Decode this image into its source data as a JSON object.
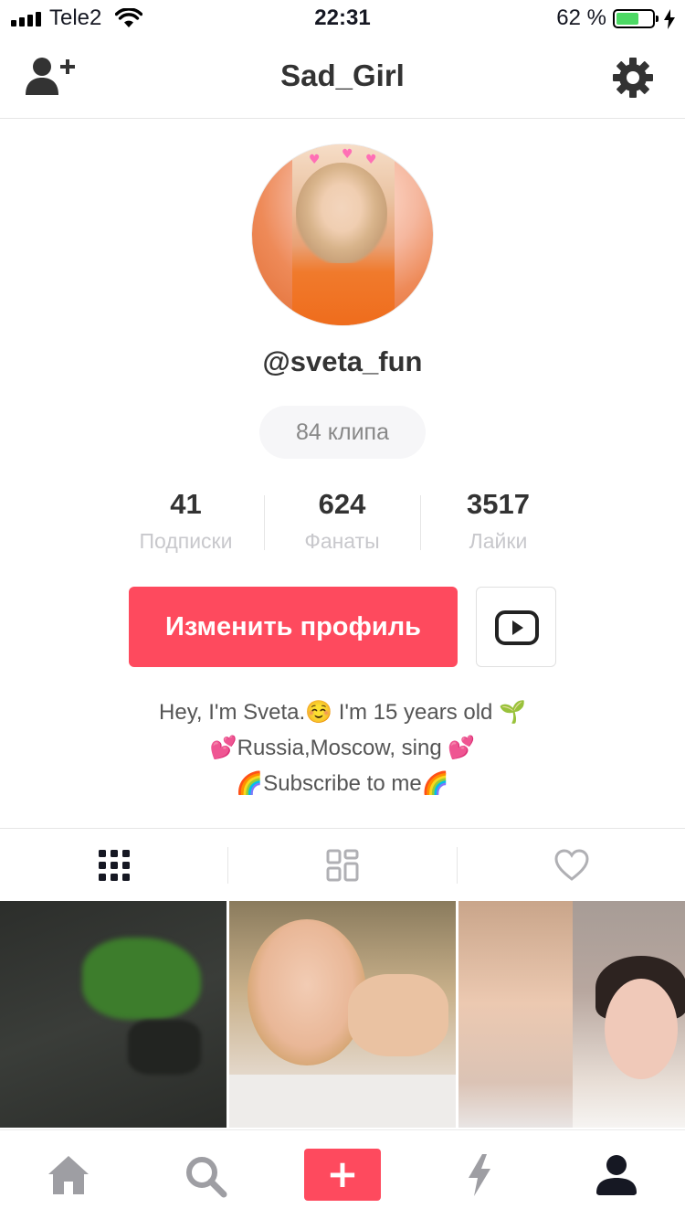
{
  "status_bar": {
    "carrier": "Tele2",
    "time": "22:31",
    "battery_percent_label": "62 %",
    "battery_level": 0.62,
    "icons": [
      "signal-icon",
      "wifi-icon",
      "battery-icon",
      "charging-bolt-icon"
    ]
  },
  "header": {
    "title": "Sad_Girl",
    "left_icon": "add-user-icon",
    "right_icon": "gear-icon"
  },
  "profile": {
    "username": "@sveta_fun",
    "clips_label": "84 клипа",
    "stats": [
      {
        "value": "41",
        "label": "Подписки"
      },
      {
        "value": "624",
        "label": "Фанаты"
      },
      {
        "value": "3517",
        "label": "Лайки"
      }
    ],
    "edit_button_label": "Изменить профиль",
    "youtube_icon": "youtube-icon",
    "bio_lines": [
      "Hey, I'm Sveta.☺️ I'm 15 years old 🌱",
      "💕Russia,Moscow, sing 💕",
      "🌈Subscribe to me🌈"
    ]
  },
  "tabs": [
    {
      "icon": "grid-icon",
      "active": true
    },
    {
      "icon": "collage-icon",
      "active": false
    },
    {
      "icon": "heart-icon",
      "active": false
    }
  ],
  "bottom_nav": {
    "items": [
      "home-icon",
      "search-icon",
      "plus-icon",
      "notifications-bolt-icon",
      "profile-icon"
    ],
    "plus_label": "+"
  },
  "colors": {
    "accent": "#fe4a5e",
    "text_dark": "#333333",
    "text_muted": "#c8c8cc",
    "battery_green": "#4cd964"
  }
}
